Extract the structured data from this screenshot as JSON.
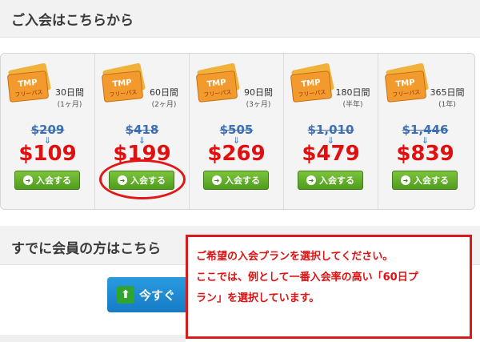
{
  "header": {
    "title": "ご入会はこちらから"
  },
  "plans": [
    {
      "days": "30日間",
      "months": "(1ヶ月)",
      "old_price": "$209",
      "arrow": "⇓",
      "price": "$109",
      "button": "入会する"
    },
    {
      "days": "60日間",
      "months": "(2ヶ月)",
      "old_price": "$418",
      "arrow": "⇓",
      "price": "$199",
      "button": "入会する"
    },
    {
      "days": "90日間",
      "months": "(3ヶ月)",
      "old_price": "$505",
      "arrow": "⇓",
      "price": "$269",
      "button": "入会する"
    },
    {
      "days": "180日間",
      "months": "(半年)",
      "old_price": "$1,010",
      "arrow": "⇓",
      "price": "$479",
      "button": "入会する"
    },
    {
      "days": "365日間",
      "months": "(1年)",
      "old_price": "$1,446",
      "arrow": "⇓",
      "price": "$839",
      "button": "入会する"
    }
  ],
  "ticket": {
    "brand": "TMP",
    "label": "フリーパス"
  },
  "member_section": {
    "title": "すでに会員の方はこちら",
    "login_button": "今すぐ"
  },
  "callout": {
    "line1": "ご希望の入会プランを選択してください。",
    "line2": "ここでは、例として一番入会率の高い「60日プ",
    "line3": "ラン」を選択しています。"
  },
  "colors": {
    "price": "#e30f0f",
    "old_price": "#3d6fb4",
    "button": "#5aa623",
    "highlight": "#e01818"
  }
}
